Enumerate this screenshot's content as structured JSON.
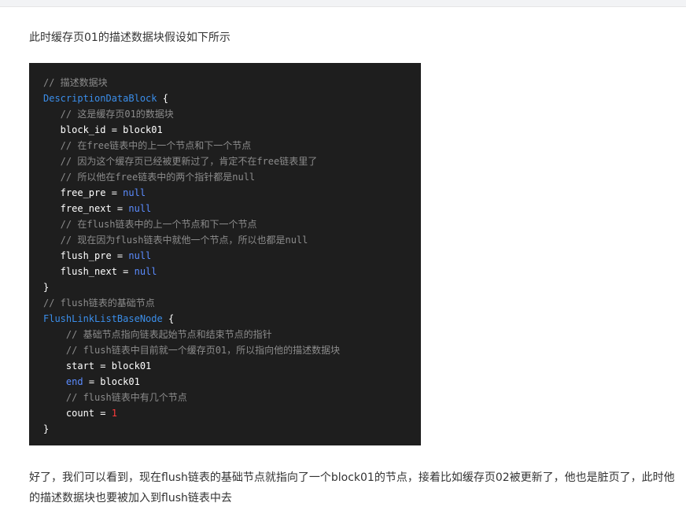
{
  "intro": "此时缓存页01的描述数据块假设如下所示",
  "code": {
    "lines": [
      [
        {
          "t": "// 描述数据块",
          "c": "c"
        }
      ],
      [
        {
          "t": "DescriptionDataBlock",
          "c": "t"
        },
        {
          "t": " {",
          "c": "p"
        }
      ],
      [
        {
          "t": "   // 这是缓存页01的数据块",
          "c": "c"
        }
      ],
      [
        {
          "t": "   block_id = block01",
          "c": "p"
        }
      ],
      [
        {
          "t": "   // 在free链表中的上一个节点和下一个节点",
          "c": "c"
        }
      ],
      [
        {
          "t": "   // 因为这个缓存页已经被更新过了，肯定不在free链表里了",
          "c": "c"
        }
      ],
      [
        {
          "t": "   // 所以他在free链表中的两个指针都是null",
          "c": "c"
        }
      ],
      [
        {
          "t": "   free_pre = ",
          "c": "p"
        },
        {
          "t": "null",
          "c": "k"
        }
      ],
      [
        {
          "t": "   free_next = ",
          "c": "p"
        },
        {
          "t": "null",
          "c": "k"
        }
      ],
      [
        {
          "t": "   // 在flush链表中的上一个节点和下一个节点",
          "c": "c"
        }
      ],
      [
        {
          "t": "   // 现在因为flush链表中就他一个节点，所以也都是null",
          "c": "c"
        }
      ],
      [
        {
          "t": "   flush_pre = ",
          "c": "p"
        },
        {
          "t": "null",
          "c": "k"
        }
      ],
      [
        {
          "t": "   flush_next = ",
          "c": "p"
        },
        {
          "t": "null",
          "c": "k"
        }
      ],
      [
        {
          "t": "}",
          "c": "p"
        }
      ],
      [
        {
          "t": "// flush链表的基础节点",
          "c": "c"
        }
      ],
      [
        {
          "t": "FlushLinkListBaseNode",
          "c": "t"
        },
        {
          "t": " {",
          "c": "p"
        }
      ],
      [
        {
          "t": "    // 基础节点指向链表起始节点和结束节点的指针",
          "c": "c"
        }
      ],
      [
        {
          "t": "    // flush链表中目前就一个缓存页01，所以指向他的描述数据块",
          "c": "c"
        }
      ],
      [
        {
          "t": "    start = block01",
          "c": "p"
        }
      ],
      [
        {
          "t": "    ",
          "c": "p"
        },
        {
          "t": "end",
          "c": "k"
        },
        {
          "t": " = block01",
          "c": "p"
        }
      ],
      [
        {
          "t": "    // flush链表中有几个节点",
          "c": "c"
        }
      ],
      [
        {
          "t": "    count = ",
          "c": "p"
        },
        {
          "t": "1",
          "c": "n"
        }
      ],
      [
        {
          "t": "}",
          "c": "p"
        }
      ]
    ]
  },
  "outro": "好了，我们可以看到，现在flush链表的基础节点就指向了一个block01的节点，接着比如缓存页02被更新了，他也是脏页了，此时他的描述数据块也要被加入到flush链表中去",
  "colors": {
    "background": "#ffffff",
    "code_background": "#1e1e1e",
    "comment": "#8c8c8c",
    "type_name": "#3b8eea",
    "keyword": "#5b8cff",
    "number": "#ff3b3b"
  }
}
